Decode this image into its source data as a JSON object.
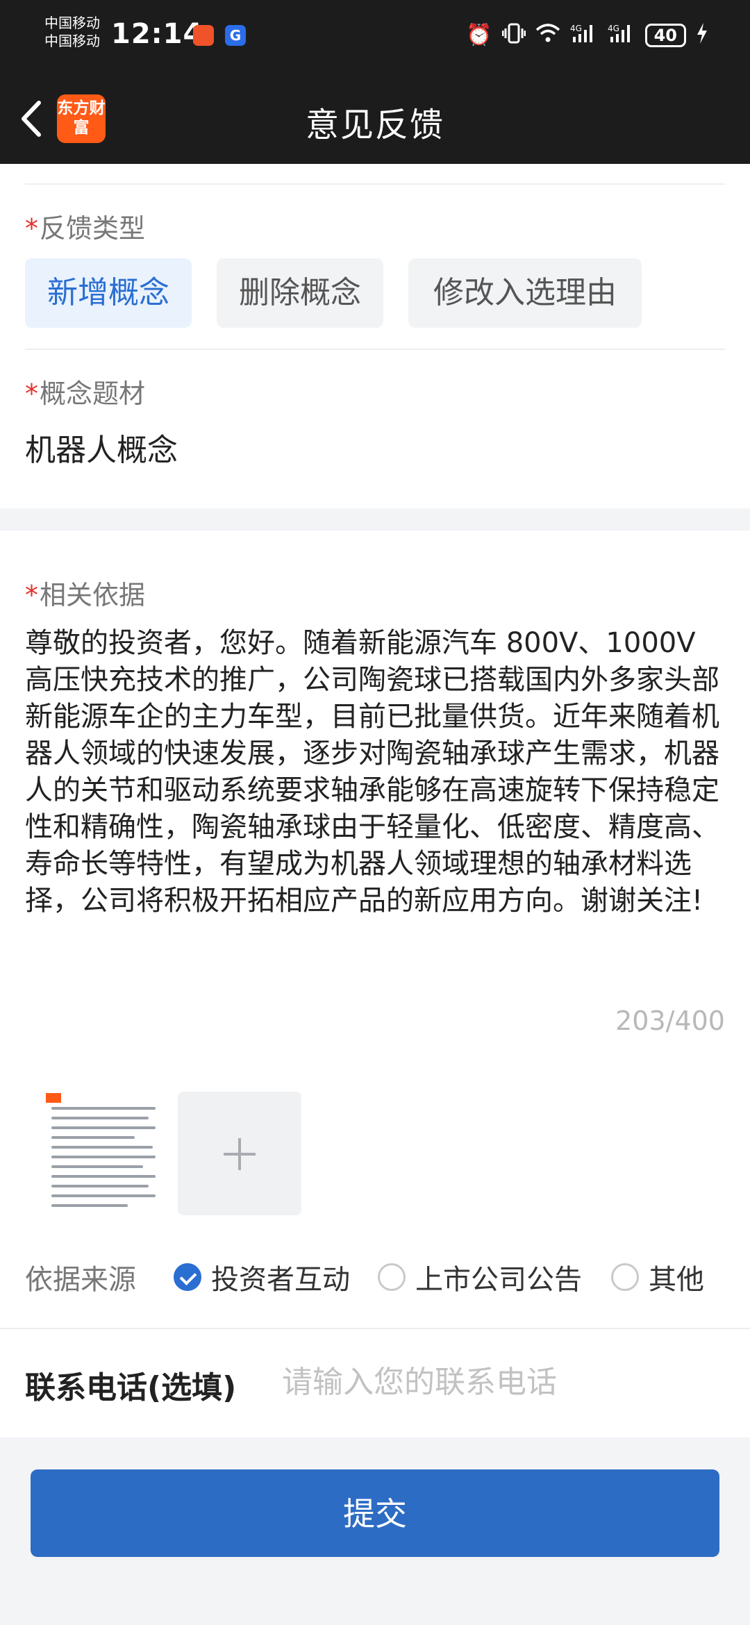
{
  "status_bar": {
    "carrier_1": "中国移动",
    "carrier_2": "中国移动",
    "time": "12:14",
    "battery": "40"
  },
  "header": {
    "title": "意见反馈",
    "logo_text": "东方财富"
  },
  "feedback_type": {
    "required_mark": "*",
    "label": "反馈类型",
    "options": [
      "新增概念",
      "删除概念",
      "修改入选理由"
    ],
    "selected": "新增概念"
  },
  "concept": {
    "required_mark": "*",
    "label": "概念题材",
    "value": "机器人概念"
  },
  "basis": {
    "required_mark": "*",
    "label": "相关依据",
    "text": "尊敬的投资者，您好。随着新能源汽车 800V、1000V 高压快充技术的推广，公司陶瓷球已搭载国内外多家头部新能源车企的主力车型，目前已批量供货。近年来随着机器人领域的快速发展，逐步对陶瓷轴承球产生需求，机器人的关节和驱动系统要求轴承能够在高速旋转下保持稳定性和精确性，陶瓷轴承球由于轻量化、低密度、精度高、寿命长等特性，有望成为机器人领域理想的轴承材料选择，公司将积极开拓相应产品的新应用方向。谢谢关注!",
    "counter": "203/400"
  },
  "source": {
    "label": "依据来源",
    "options": [
      "投资者互动",
      "上市公司公告",
      "其他"
    ],
    "selected": "投资者互动"
  },
  "contact": {
    "label": "联系电话(选填)",
    "placeholder": "请输入您的联系电话",
    "value": ""
  },
  "submit": {
    "label": "提交"
  },
  "colors": {
    "accent": "#2a6ed2",
    "submit_bg": "#2d6cc4",
    "required": "#e3302b",
    "header_bg": "#1c1c1c"
  }
}
